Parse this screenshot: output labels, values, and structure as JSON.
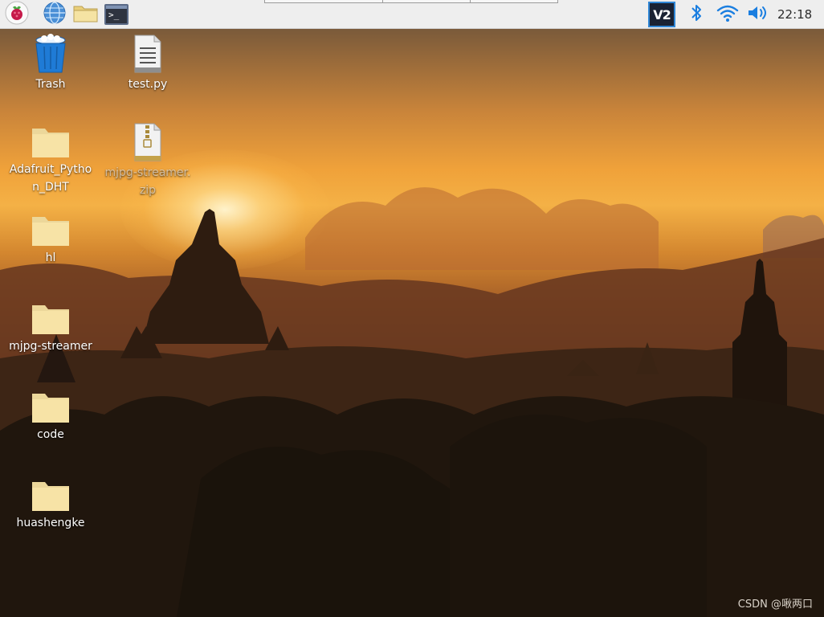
{
  "taskbar": {
    "launchers": [
      {
        "name": "raspberry-menu",
        "icon": "raspberry-icon"
      },
      {
        "name": "web-browser",
        "icon": "globe-icon"
      },
      {
        "name": "file-manager",
        "icon": "folder-icon"
      },
      {
        "name": "terminal",
        "icon": "terminal-icon",
        "glyph": ">_"
      }
    ],
    "tray": {
      "vnc_label": "V2",
      "icons": [
        "vnc-icon",
        "bluetooth-icon",
        "wifi-icon",
        "volume-icon"
      ]
    },
    "clock": "22:18"
  },
  "desktop_icons": [
    {
      "label": "Trash",
      "type": "trash"
    },
    {
      "label": "test.py",
      "type": "text-file"
    },
    {
      "label": "Adafruit_Python_DHT",
      "type": "folder"
    },
    {
      "label": "mjpg-streamer.zip",
      "type": "zip-file"
    },
    {
      "label": "hl",
      "type": "folder"
    },
    {
      "label": "mjpg-streamer",
      "type": "folder"
    },
    {
      "label": "code",
      "type": "folder"
    },
    {
      "label": "huashengke",
      "type": "folder"
    }
  ],
  "watermark": "CSDN @啾两口",
  "colors": {
    "taskbar": "#eeeeee",
    "folder": "#f7e3a6",
    "trash": "#1f7bd6",
    "tray_blue": "#1a7ee0"
  }
}
